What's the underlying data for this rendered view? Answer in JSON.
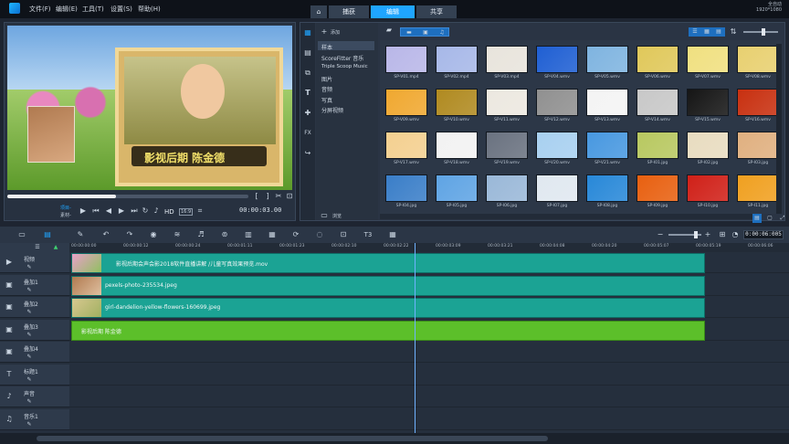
{
  "menu": {
    "file": "文件(F)",
    "edit": "编辑(E)",
    "tools": "工具(T)",
    "settings": "设置(S)",
    "help": "帮助(H)"
  },
  "tabs": {
    "home_icon": "home-icon",
    "capture": "捕获",
    "edit": "编辑",
    "share": "共享"
  },
  "resolution": {
    "line1": "全自动",
    "line2": "1920*1080"
  },
  "preview": {
    "title": "影视后期 陈金德",
    "project_label": "项目-",
    "clip_label": "素材-",
    "hd": "HD",
    "ratio": "16:9",
    "timecode": "00:00:03.00",
    "progress": 0.45
  },
  "library": {
    "add_label": "添加",
    "browse_label": "浏览",
    "folders": [
      "样本",
      "ScoreFitter 音乐",
      "Triple Scoop Music",
      "图片",
      "音频",
      "写真",
      "分屏视频"
    ],
    "thumbs": [
      {
        "label": "SP-V01.mp4",
        "c": "#b9b7e8"
      },
      {
        "label": "SP-V02.mp4",
        "c": "#a7b8e8"
      },
      {
        "label": "SP-V03.mp4",
        "c": "#e8e4dc"
      },
      {
        "label": "SP-V04.wmv",
        "c": "#1f5fd3"
      },
      {
        "label": "SP-V05.wmv",
        "c": "#7fb4e0"
      },
      {
        "label": "SP-V06.wmv",
        "c": "#e0c85a"
      },
      {
        "label": "SP-V07.wmv",
        "c": "#f0e080"
      },
      {
        "label": "SP-V08.wmv",
        "c": "#e8d070"
      },
      {
        "label": "SP-V09.wmv",
        "c": "#f0a830"
      },
      {
        "label": "SP-V10.wmv",
        "c": "#b08a20"
      },
      {
        "label": "SP-V11.wmv",
        "c": "#ece8e0"
      },
      {
        "label": "SP-V12.wmv",
        "c": "#909090"
      },
      {
        "label": "SP-V13.wmv",
        "c": "#f4f4f4"
      },
      {
        "label": "SP-V14.wmv",
        "c": "#c8c8c8"
      },
      {
        "label": "SP-V15.wmv",
        "c": "#151515"
      },
      {
        "label": "SP-V16.wmv",
        "c": "#c83010"
      },
      {
        "label": "SP-V17.wmv",
        "c": "#f4d090"
      },
      {
        "label": "SP-V18.wmv",
        "c": "#f2f2f2"
      },
      {
        "label": "SP-V19.wmv",
        "c": "#6a7280"
      },
      {
        "label": "SP-V20.wmv",
        "c": "#a8d0f0"
      },
      {
        "label": "SP-V21.wmv",
        "c": "#4898e0"
      },
      {
        "label": "SP-I01.jpg",
        "c": "#b8c860"
      },
      {
        "label": "SP-I02.jpg",
        "c": "#e8dcc0"
      },
      {
        "label": "SP-I03.jpg",
        "c": "#e0b080"
      },
      {
        "label": "SP-I04.jpg",
        "c": "#3a7ec8"
      },
      {
        "label": "SP-I05.jpg",
        "c": "#5fa4e4"
      },
      {
        "label": "SP-I06.jpg",
        "c": "#9ab8d8"
      },
      {
        "label": "SP-I07.jpg",
        "c": "#e0e8f0"
      },
      {
        "label": "SP-I08.jpg",
        "c": "#2888d8"
      },
      {
        "label": "SP-I09.jpg",
        "c": "#e86010"
      },
      {
        "label": "SP-I10.jpg",
        "c": "#d02018"
      },
      {
        "label": "SP-I11.jpg",
        "c": "#f0a020"
      }
    ]
  },
  "timeline": {
    "zoom_time": "0:00:06:005",
    "ruler": [
      "00:00:00:00",
      "00:00:00:12",
      "00:00:00:24",
      "00:00:01:11",
      "00:00:01:23",
      "00:00:02:10",
      "00:00:02:22",
      "00:00:03:09",
      "00:00:03:21",
      "00:00:04:08",
      "00:00:04:20",
      "00:00:05:07",
      "00:00:05:19",
      "00:00:06:06"
    ],
    "playhead_fraction": 0.48,
    "tracks": [
      {
        "name": "视频",
        "clip": "影视后期会声会影2018软件直播讲解 /儿童写真效果预览.mov"
      },
      {
        "name": "叠加1",
        "clip": "pexels-photo-235534.jpeg"
      },
      {
        "name": "叠加2",
        "clip": "girl-dandelion-yellow-flowers-160699.jpeg"
      },
      {
        "name": "叠加3",
        "clip": "影视后期 陈金德"
      },
      {
        "name": "叠加4",
        "clip": ""
      },
      {
        "name": "标题1",
        "clip": ""
      },
      {
        "name": "声音",
        "clip": ""
      },
      {
        "name": "音乐1",
        "clip": ""
      }
    ]
  },
  "colors": {
    "accent": "#1fa5ff",
    "clip": "#1ba394",
    "title_clip": "#5cbf2a"
  }
}
